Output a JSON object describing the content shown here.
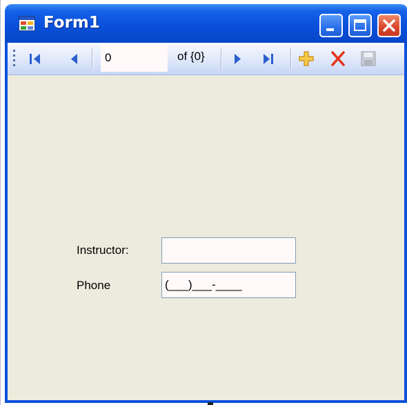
{
  "window": {
    "title": "Form1",
    "icons": {
      "app": "form-app-icon",
      "minimize": "minimize-icon",
      "maximize": "maximize-icon",
      "close": "close-icon"
    },
    "colors": {
      "title_bar": "#0a50db",
      "client_bg": "#ecebdd",
      "close_button": "#d8452a"
    }
  },
  "toolbar": {
    "position_value": "0",
    "count_label": "of {0}",
    "icons": {
      "grip": "toolbar-grip-icon",
      "move_first": "move-first-icon",
      "move_previous": "move-previous-icon",
      "move_next": "move-next-icon",
      "move_last": "move-last-icon",
      "add_new": "add-new-icon",
      "delete": "delete-icon",
      "save": "save-icon"
    }
  },
  "form": {
    "instructor_label": "Instructor:",
    "instructor_value": "",
    "phone_label": "Phone",
    "phone_value": "(___)___-____"
  }
}
